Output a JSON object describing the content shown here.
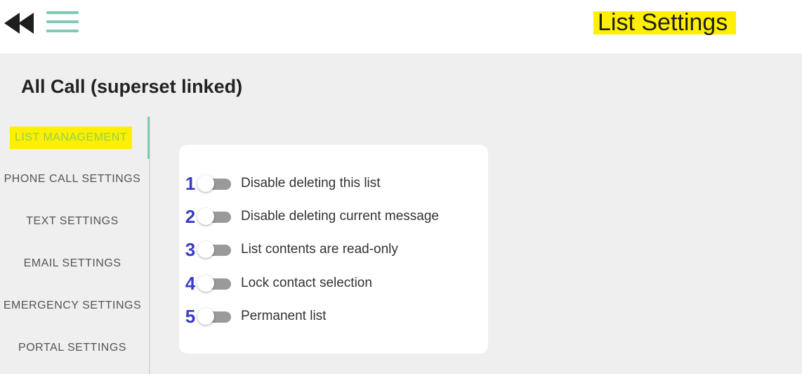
{
  "header": {
    "title": "List Settings",
    "back_icon": "rewind-icon",
    "menu_icon": "hamburger-menu-icon",
    "title_highlight_color": "#ffef00",
    "menu_color": "#7fc9b6"
  },
  "list": {
    "name": "All Call (superset linked)"
  },
  "sidebar": {
    "items": [
      {
        "label": "LIST MANAGEMENT",
        "active": true
      },
      {
        "label": "PHONE CALL SETTINGS",
        "active": false
      },
      {
        "label": "TEXT SETTINGS",
        "active": false
      },
      {
        "label": "EMAIL SETTINGS",
        "active": false
      },
      {
        "label": "EMERGENCY SETTINGS",
        "active": false
      },
      {
        "label": "PORTAL SETTINGS",
        "active": false
      }
    ],
    "active_text_color": "#8fd14f"
  },
  "options": [
    {
      "number": "1",
      "label": "Disable deleting this list",
      "enabled": false
    },
    {
      "number": "2",
      "label": "Disable deleting current message",
      "enabled": false
    },
    {
      "number": "3",
      "label": "List contents are read-only",
      "enabled": false
    },
    {
      "number": "4",
      "label": "Lock contact selection",
      "enabled": false
    },
    {
      "number": "5",
      "label": "Permanent list",
      "enabled": false
    }
  ],
  "annotation_color": "#3a3dc4"
}
